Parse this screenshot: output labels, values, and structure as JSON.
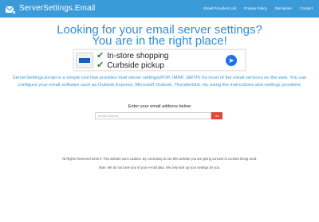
{
  "header": {
    "brand": "ServerSettings.Email",
    "nav": [
      "Email Providers List",
      "Privacy Policy",
      "Disclaimer",
      "Contact"
    ]
  },
  "hero": {
    "line1": "Looking for your email server settings?",
    "line2": "You are in the right place!"
  },
  "ad": {
    "line1": "In-store shopping",
    "line2": "Curbside pickup"
  },
  "intro": "ServerSettings.Email is a simple tool that provides mail server settings(POP, IMAP, SMTP) for most of the email services on the web. You can configure your email software such as Outlook Express, Microsoft Outlook, Thunderbird, etc using the instructions and settings provided.",
  "form": {
    "label": "Enter your email address below",
    "placeholder": "Email Address",
    "button": "Go"
  },
  "footer": {
    "line1": "All Rights Reserved 2018 © This website uses cookies. By continuing to use this website you are giving consent to cookies being used.",
    "line2": "Note: We do not save any of your e-mail data. We only look up your settings for you."
  },
  "colors": {
    "brand_blue": "#3a9bd8",
    "button_red": "#e0473a"
  }
}
